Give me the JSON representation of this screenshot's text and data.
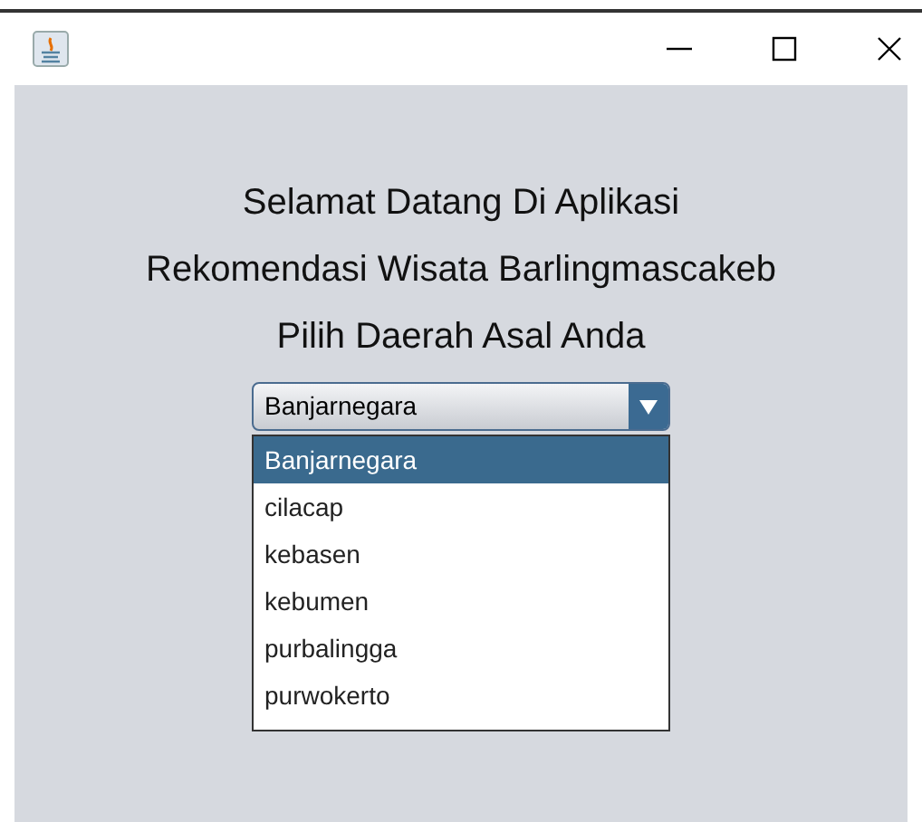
{
  "headings": [
    "Selamat Datang Di Aplikasi",
    "Rekomendasi Wisata Barlingmascakeb",
    "Pilih Daerah Asal Anda"
  ],
  "combo": {
    "value": "Banjarnegara",
    "expanded": true,
    "options": [
      {
        "label": "Banjarnegara",
        "selected": true
      },
      {
        "label": "cilacap",
        "selected": false
      },
      {
        "label": "kebasen",
        "selected": false
      },
      {
        "label": "kebumen",
        "selected": false
      },
      {
        "label": "purbalingga",
        "selected": false
      },
      {
        "label": "purwokerto",
        "selected": false
      }
    ]
  }
}
